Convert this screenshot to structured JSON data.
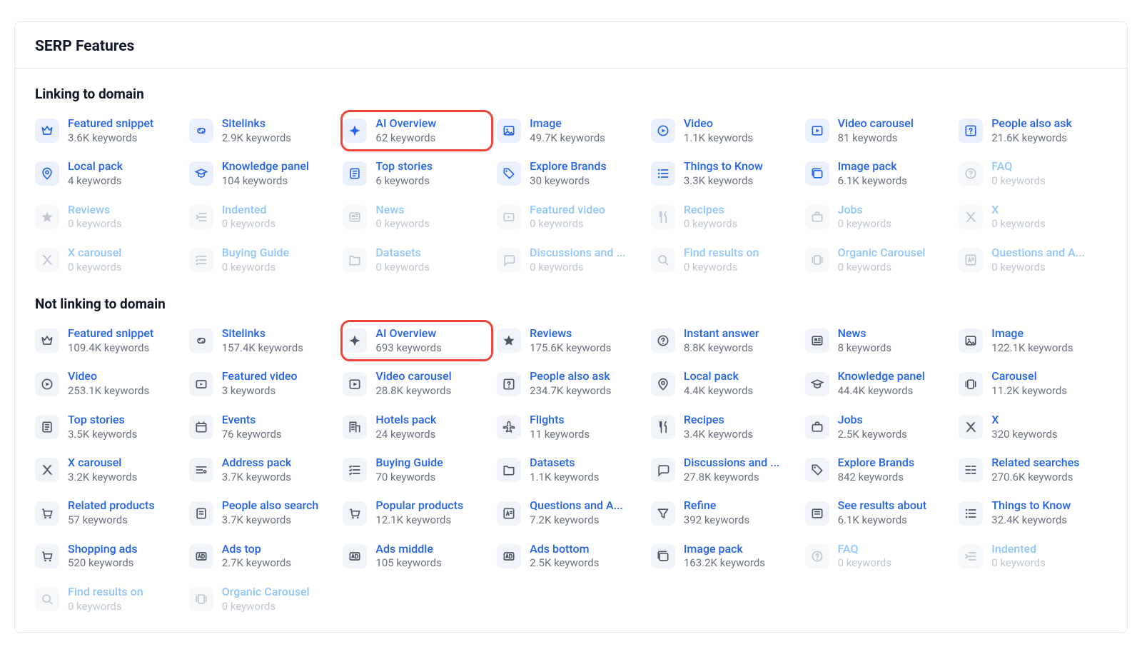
{
  "card": {
    "title": "SERP Features"
  },
  "sections": {
    "linking": {
      "title": "Linking to domain",
      "items": [
        {
          "id": "featured-snippet",
          "title": "Featured snippet",
          "sub": "3.6K keywords",
          "icon": "crown",
          "accent": true
        },
        {
          "id": "sitelinks",
          "title": "Sitelinks",
          "sub": "2.9K keywords",
          "icon": "link",
          "accent": true
        },
        {
          "id": "ai-overview",
          "title": "AI Overview",
          "sub": "62 keywords",
          "icon": "spark",
          "accent": true,
          "highlight": true
        },
        {
          "id": "image",
          "title": "Image",
          "sub": "49.7K keywords",
          "icon": "image",
          "accent": true
        },
        {
          "id": "video",
          "title": "Video",
          "sub": "1.1K keywords",
          "icon": "play-circle",
          "accent": true
        },
        {
          "id": "video-carousel",
          "title": "Video carousel",
          "sub": "81 keywords",
          "icon": "play-square",
          "accent": true
        },
        {
          "id": "people-also-ask",
          "title": "People also ask",
          "sub": "21.6K keywords",
          "icon": "question-box",
          "accent": true
        },
        {
          "id": "local-pack",
          "title": "Local pack",
          "sub": "4 keywords",
          "icon": "pin",
          "accent": true
        },
        {
          "id": "knowledge-panel",
          "title": "Knowledge panel",
          "sub": "104 keywords",
          "icon": "grad-cap",
          "accent": true
        },
        {
          "id": "top-stories",
          "title": "Top stories",
          "sub": "6 keywords",
          "icon": "news",
          "accent": true
        },
        {
          "id": "explore-brands",
          "title": "Explore Brands",
          "sub": "30 keywords",
          "icon": "tag",
          "accent": true
        },
        {
          "id": "things-to-know",
          "title": "Things to Know",
          "sub": "3.3K keywords",
          "icon": "list",
          "accent": true
        },
        {
          "id": "image-pack",
          "title": "Image pack",
          "sub": "6.1K keywords",
          "icon": "image-stack",
          "accent": true
        },
        {
          "id": "faq",
          "title": "FAQ",
          "sub": "0 keywords",
          "icon": "help-circle",
          "dim": true
        },
        {
          "id": "reviews",
          "title": "Reviews",
          "sub": "0 keywords",
          "icon": "star",
          "dim": true
        },
        {
          "id": "indented",
          "title": "Indented",
          "sub": "0 keywords",
          "icon": "indent",
          "dim": true
        },
        {
          "id": "news",
          "title": "News",
          "sub": "0 keywords",
          "icon": "newspaper",
          "dim": true
        },
        {
          "id": "featured-video",
          "title": "Featured video",
          "sub": "0 keywords",
          "icon": "video-box",
          "dim": true
        },
        {
          "id": "recipes",
          "title": "Recipes",
          "sub": "0 keywords",
          "icon": "utensils",
          "dim": true
        },
        {
          "id": "jobs",
          "title": "Jobs",
          "sub": "0 keywords",
          "icon": "briefcase",
          "dim": true
        },
        {
          "id": "x",
          "title": "X",
          "sub": "0 keywords",
          "icon": "x-logo",
          "dim": true
        },
        {
          "id": "x-carousel",
          "title": "X carousel",
          "sub": "0 keywords",
          "icon": "x-logo",
          "dim": true
        },
        {
          "id": "buying-guide",
          "title": "Buying Guide",
          "sub": "0 keywords",
          "icon": "checklist",
          "dim": true
        },
        {
          "id": "datasets",
          "title": "Datasets",
          "sub": "0 keywords",
          "icon": "folder",
          "dim": true
        },
        {
          "id": "discussions",
          "title": "Discussions and ...",
          "sub": "0 keywords",
          "icon": "chat",
          "dim": true
        },
        {
          "id": "find-results-on",
          "title": "Find results on",
          "sub": "0 keywords",
          "icon": "search-circle",
          "dim": true
        },
        {
          "id": "organic-carousel",
          "title": "Organic Carousel",
          "sub": "0 keywords",
          "icon": "carousel",
          "dim": true
        },
        {
          "id": "questions-answers",
          "title": "Questions and A...",
          "sub": "0 keywords",
          "icon": "qa",
          "dim": true
        }
      ]
    },
    "notlinking": {
      "title": "Not linking to domain",
      "items": [
        {
          "id": "featured-snippet",
          "title": "Featured snippet",
          "sub": "109.4K keywords",
          "icon": "crown"
        },
        {
          "id": "sitelinks",
          "title": "Sitelinks",
          "sub": "157.4K keywords",
          "icon": "link"
        },
        {
          "id": "ai-overview",
          "title": "AI Overview",
          "sub": "693 keywords",
          "icon": "spark",
          "highlight": true
        },
        {
          "id": "reviews",
          "title": "Reviews",
          "sub": "175.6K keywords",
          "icon": "star"
        },
        {
          "id": "instant-answer",
          "title": "Instant answer",
          "sub": "8.8K keywords",
          "icon": "help-circle"
        },
        {
          "id": "news",
          "title": "News",
          "sub": "8 keywords",
          "icon": "newspaper"
        },
        {
          "id": "image",
          "title": "Image",
          "sub": "122.1K keywords",
          "icon": "image"
        },
        {
          "id": "video",
          "title": "Video",
          "sub": "253.1K keywords",
          "icon": "play-circle"
        },
        {
          "id": "featured-video",
          "title": "Featured video",
          "sub": "3 keywords",
          "icon": "video-box"
        },
        {
          "id": "video-carousel",
          "title": "Video carousel",
          "sub": "28.8K keywords",
          "icon": "play-square"
        },
        {
          "id": "people-also-ask",
          "title": "People also ask",
          "sub": "234.7K keywords",
          "icon": "question-box"
        },
        {
          "id": "local-pack",
          "title": "Local pack",
          "sub": "4.4K keywords",
          "icon": "pin"
        },
        {
          "id": "knowledge-panel",
          "title": "Knowledge panel",
          "sub": "44.4K keywords",
          "icon": "grad-cap"
        },
        {
          "id": "carousel",
          "title": "Carousel",
          "sub": "11.2K keywords",
          "icon": "carousel"
        },
        {
          "id": "top-stories",
          "title": "Top stories",
          "sub": "3.5K keywords",
          "icon": "news"
        },
        {
          "id": "events",
          "title": "Events",
          "sub": "76 keywords",
          "icon": "calendar"
        },
        {
          "id": "hotels-pack",
          "title": "Hotels pack",
          "sub": "24 keywords",
          "icon": "hotel"
        },
        {
          "id": "flights",
          "title": "Flights",
          "sub": "11 keywords",
          "icon": "plane"
        },
        {
          "id": "recipes",
          "title": "Recipes",
          "sub": "3.4K keywords",
          "icon": "utensils"
        },
        {
          "id": "jobs",
          "title": "Jobs",
          "sub": "2.5K keywords",
          "icon": "briefcase"
        },
        {
          "id": "x",
          "title": "X",
          "sub": "320 keywords",
          "icon": "x-logo"
        },
        {
          "id": "x-carousel",
          "title": "X carousel",
          "sub": "3.2K keywords",
          "icon": "x-logo"
        },
        {
          "id": "address-pack",
          "title": "Address pack",
          "sub": "3.7K keywords",
          "icon": "address"
        },
        {
          "id": "buying-guide",
          "title": "Buying Guide",
          "sub": "70 keywords",
          "icon": "checklist"
        },
        {
          "id": "datasets",
          "title": "Datasets",
          "sub": "1.1K keywords",
          "icon": "folder"
        },
        {
          "id": "discussions",
          "title": "Discussions and ...",
          "sub": "27.8K keywords",
          "icon": "chat"
        },
        {
          "id": "explore-brands",
          "title": "Explore Brands",
          "sub": "842 keywords",
          "icon": "tag"
        },
        {
          "id": "related-searches",
          "title": "Related searches",
          "sub": "270.6K keywords",
          "icon": "related"
        },
        {
          "id": "related-products",
          "title": "Related products",
          "sub": "57 keywords",
          "icon": "cart"
        },
        {
          "id": "people-also-search",
          "title": "People also search",
          "sub": "3.7K keywords",
          "icon": "document"
        },
        {
          "id": "popular-products",
          "title": "Popular products",
          "sub": "12.1K keywords",
          "icon": "cart"
        },
        {
          "id": "questions-answers",
          "title": "Questions and A...",
          "sub": "7.2K keywords",
          "icon": "qa"
        },
        {
          "id": "refine",
          "title": "Refine",
          "sub": "392 keywords",
          "icon": "funnel"
        },
        {
          "id": "see-results-about",
          "title": "See results about",
          "sub": "6.1K keywords",
          "icon": "results"
        },
        {
          "id": "things-to-know",
          "title": "Things to Know",
          "sub": "32.4K keywords",
          "icon": "list"
        },
        {
          "id": "shopping-ads",
          "title": "Shopping ads",
          "sub": "520 keywords",
          "icon": "cart"
        },
        {
          "id": "ads-top",
          "title": "Ads top",
          "sub": "2.7K keywords",
          "icon": "ad"
        },
        {
          "id": "ads-middle",
          "title": "Ads middle",
          "sub": "105 keywords",
          "icon": "ad"
        },
        {
          "id": "ads-bottom",
          "title": "Ads bottom",
          "sub": "2.5K keywords",
          "icon": "ad"
        },
        {
          "id": "image-pack",
          "title": "Image pack",
          "sub": "163.2K keywords",
          "icon": "image-stack"
        },
        {
          "id": "faq",
          "title": "FAQ",
          "sub": "0 keywords",
          "icon": "help-circle",
          "dim": true
        },
        {
          "id": "indented",
          "title": "Indented",
          "sub": "0 keywords",
          "icon": "indent",
          "dim": true
        },
        {
          "id": "find-results-on",
          "title": "Find results on",
          "sub": "0 keywords",
          "icon": "search-circle",
          "dim": true
        },
        {
          "id": "organic-carousel",
          "title": "Organic Carousel",
          "sub": "0 keywords",
          "icon": "carousel",
          "dim": true
        }
      ]
    }
  }
}
